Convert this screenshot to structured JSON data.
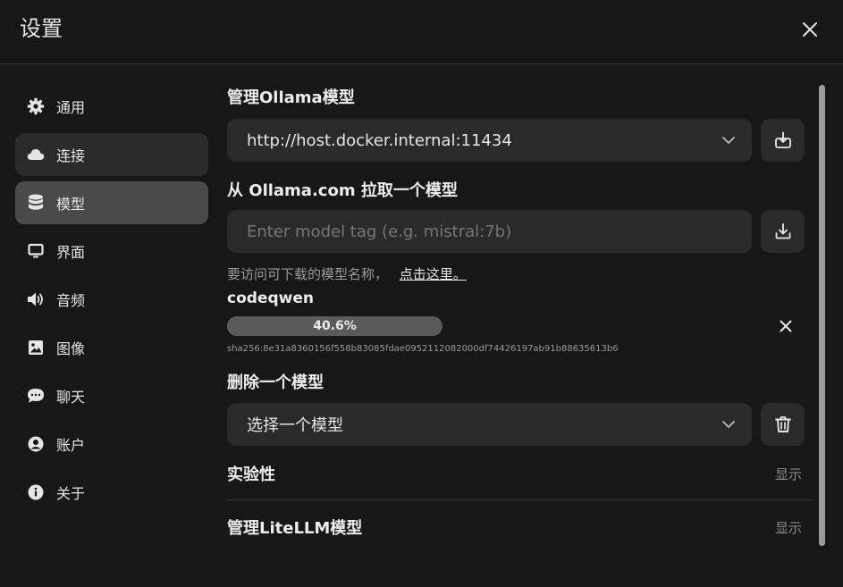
{
  "header": {
    "title": "设置"
  },
  "sidebar": {
    "items": [
      {
        "label": "通用",
        "icon": "gear-icon"
      },
      {
        "label": "连接",
        "icon": "cloud-icon"
      },
      {
        "label": "模型",
        "icon": "database-icon"
      },
      {
        "label": "界面",
        "icon": "monitor-icon"
      },
      {
        "label": "音频",
        "icon": "speaker-icon"
      },
      {
        "label": "图像",
        "icon": "image-icon"
      },
      {
        "label": "聊天",
        "icon": "chat-icon"
      },
      {
        "label": "账户",
        "icon": "user-circle-icon"
      },
      {
        "label": "关于",
        "icon": "info-icon"
      }
    ]
  },
  "main": {
    "manage_title": "管理Ollama模型",
    "ollama_url": "http://host.docker.internal:11434",
    "pull_title": "从 Ollama.com 拉取一个模型",
    "pull_placeholder": "Enter model tag (e.g. mistral:7b)",
    "hint_text": "要访问可下载的模型名称，",
    "hint_link": "点击这里。",
    "download": {
      "model": "codeqwen",
      "progress_label": "40.6%",
      "progress": 0.406,
      "digest": "sha256:8e31a8360156f558b83085fdae0952112082000df74426197ab91b88635613b6"
    },
    "delete_title": "删除一个模型",
    "delete_select": "选择一个模型",
    "experimental_title": "实验性",
    "experimental_show": "显示",
    "litellm_title": "管理LiteLLM模型",
    "litellm_show": "显示"
  },
  "colors": {
    "background": "#171717",
    "panel": "#2a2a2a",
    "active": "#4a4a4a",
    "progress_track": "#5a5a5a"
  }
}
